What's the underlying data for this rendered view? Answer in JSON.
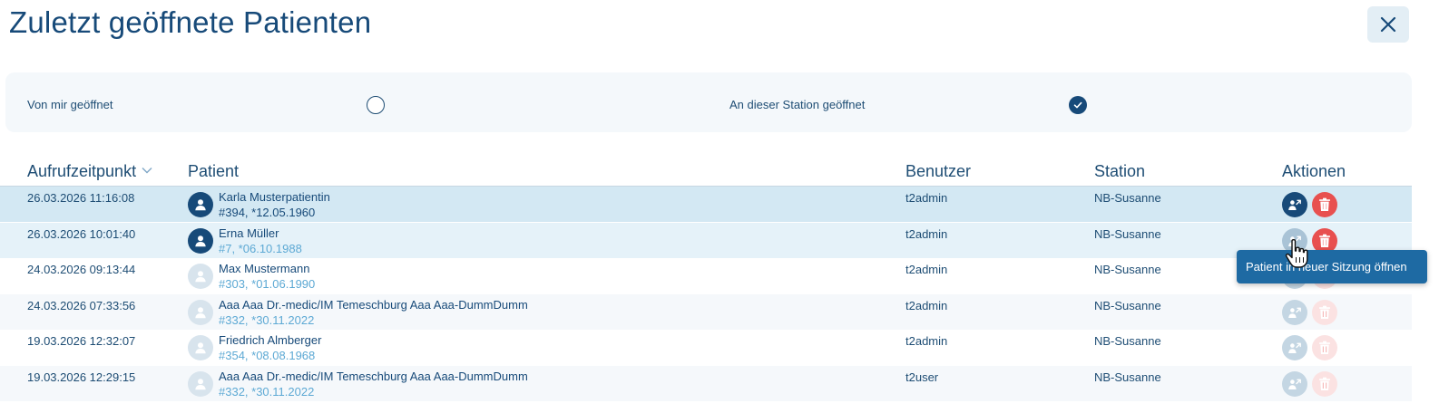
{
  "dialog": {
    "title": "Zuletzt geöffnete Patienten",
    "close_icon": "close-icon"
  },
  "filters": {
    "opened_by_me": {
      "label": "Von mir geöffnet",
      "checked": false
    },
    "opened_at_station": {
      "label": "An dieser Station geöffnet",
      "checked": true
    }
  },
  "table": {
    "columns": {
      "timestamp": "Aufrufzeitpunkt",
      "patient": "Patient",
      "user": "Benutzer",
      "station": "Station",
      "actions": "Aktionen"
    },
    "sort_icon": "chevron-down-icon",
    "rows": [
      {
        "timestamp": "26.03.2026 11:16:08",
        "name": "Karla Musterpatientin",
        "sub": "#394, *12.05.1960",
        "user": "t2admin",
        "station": "NB-Susanne",
        "state": "selected"
      },
      {
        "timestamp": "26.03.2026 10:01:40",
        "name": "Erna Müller",
        "sub": "#7, *06.10.1988",
        "user": "t2admin",
        "station": "NB-Susanne",
        "state": "hover"
      },
      {
        "timestamp": "24.03.2026 09:13:44",
        "name": "Max Mustermann",
        "sub": "#303, *01.06.1990",
        "user": "t2admin",
        "station": "NB-Susanne",
        "state": "inactive"
      },
      {
        "timestamp": "24.03.2026 07:33:56",
        "name": "Aaa Aaa Dr.-medic/IM Temeschburg Aaa Aaa-DummDumm",
        "sub": "#332, *30.11.2022",
        "user": "t2admin",
        "station": "NB-Susanne",
        "state": "inactive"
      },
      {
        "timestamp": "19.03.2026 12:32:07",
        "name": "Friedrich Almberger",
        "sub": "#354, *08.08.1968",
        "user": "t2admin",
        "station": "NB-Susanne",
        "state": "inactive"
      },
      {
        "timestamp": "19.03.2026 12:29:15",
        "name": "Aaa Aaa Dr.-medic/IM Temeschburg Aaa Aaa-DummDumm",
        "sub": "#332, *30.11.2022",
        "user": "t2user",
        "station": "NB-Susanne",
        "state": "inactive"
      }
    ],
    "row_icons": {
      "avatar": "person-avatar-icon",
      "open": "open-in-new-session-icon",
      "delete": "trash-icon"
    }
  },
  "tooltip": {
    "text": "Patient in neuer Sitzung öffnen"
  },
  "colors": {
    "primary": "#174a79",
    "selected_row": "#d3e8f3",
    "hover_row": "#e5f2f9",
    "alt_row": "#f5f8fb",
    "delete": "#e8504f",
    "delete_faded": "#fbe2e2",
    "inactive_icon": "#c4d6e3",
    "tooltip_bg": "#1e6aa3",
    "sub_link": "#5da9d4"
  }
}
